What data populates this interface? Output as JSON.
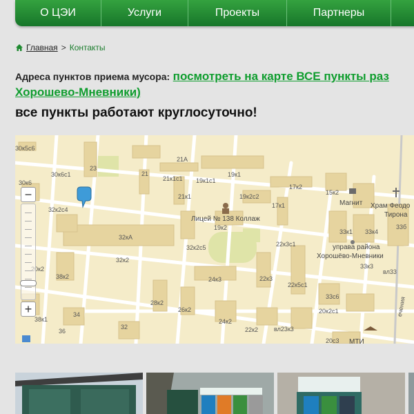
{
  "nav": {
    "items": [
      "О ЦЭИ",
      "Услуги",
      "Проекты",
      "Партнеры",
      ""
    ]
  },
  "breadcrumb": {
    "home": "Главная",
    "separator": ">",
    "current": "Контакты"
  },
  "intro": {
    "label": "Адреса пунктов приема мусора:",
    "link_part1": "посмотреть на карте ВСЕ пункты раз",
    "link_part2": "Хорошево-Мневники)",
    "note": "все пункты работают круглосуточно!"
  },
  "map": {
    "labels": [
      "30к5с6",
      "30к6с1",
      "23",
      "30к6",
      "21А",
      "21к1с1",
      "19к1с1",
      "19к1",
      "17к2",
      "15к2",
      "Магнит",
      "Храм Феодо",
      "Тирона",
      "33б",
      "21",
      "19к2с2",
      "17к1",
      "21к1",
      "32к2с4",
      "Лицей № 138 Коллаж",
      "19к2",
      "33к1",
      "33к4",
      "32кА",
      "32к2с5",
      "22к3с1",
      "управа района",
      "Хорошёво-Мневники",
      "33к3",
      "32к2",
      "20к2",
      "38к2",
      "24к3",
      "22к3",
      "22к5с1",
      "вл33",
      "28к2",
      "26к2",
      "33с6",
      "20к2с1",
      "34",
      "24к2",
      "38к1",
      "32",
      "22к2",
      "вл23к3",
      "20с3",
      "МТИ",
      "36",
      "ечения"
    ],
    "zoom_in": "+",
    "zoom_out": "−",
    "zoom_level": 0.15
  },
  "colors": {
    "nav_green": "#1f8a31",
    "link_green": "#0f9d2e",
    "map_bg": "#f5ecc9",
    "building": "#e6d49f",
    "road": "#ffffff"
  },
  "photos": [
    "photo-1",
    "photo-2",
    "photo-3",
    "photo-4"
  ]
}
